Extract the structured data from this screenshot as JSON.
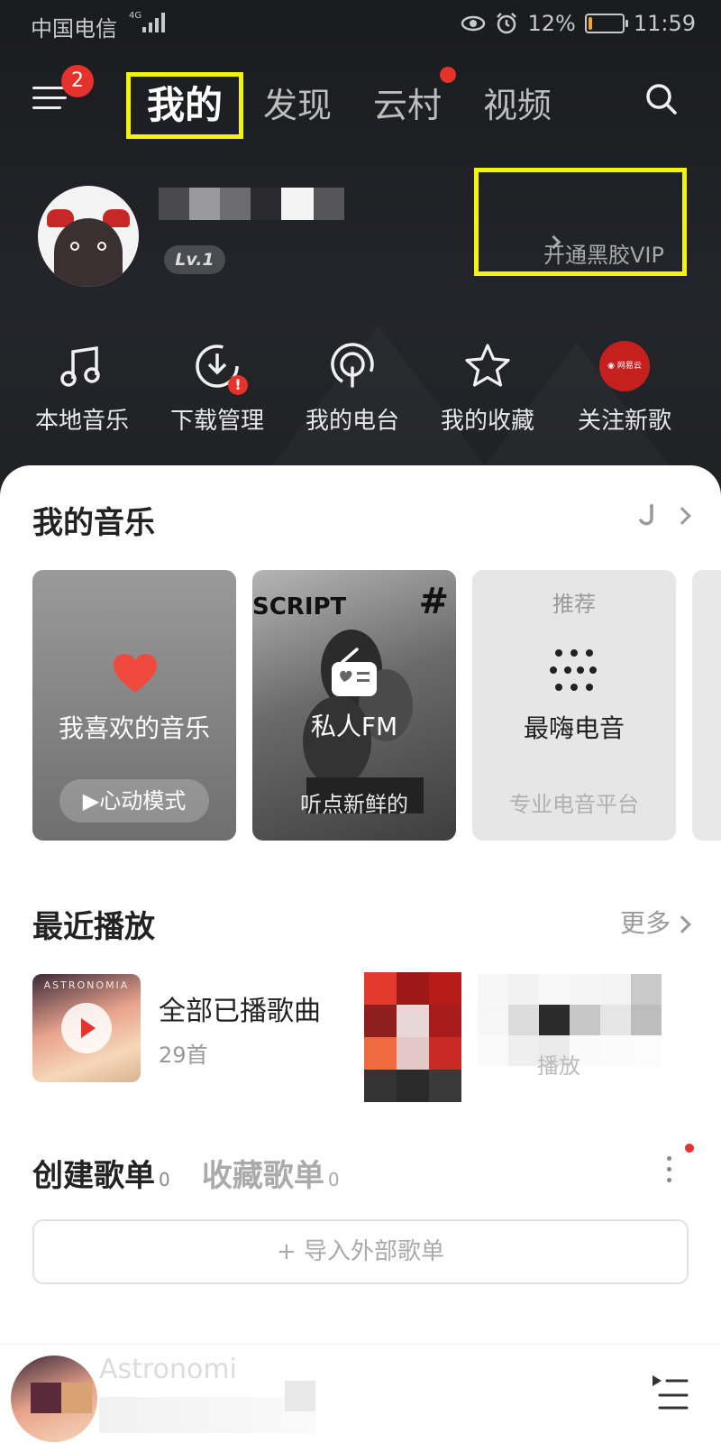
{
  "status_bar": {
    "carrier": "中国电信",
    "network": "4G",
    "battery": "12%",
    "time": "11:59",
    "battery_level": 0.12
  },
  "top_nav": {
    "menu_badge": "2",
    "tabs": [
      {
        "label": "我的",
        "active": true
      },
      {
        "label": "发现",
        "active": false
      },
      {
        "label": "云村",
        "active": false,
        "dot": true
      },
      {
        "label": "视频",
        "active": false
      }
    ]
  },
  "profile": {
    "level": "Lv.1",
    "vip_label": "开通黑胶VIP"
  },
  "quick_actions": [
    {
      "label": "本地音乐",
      "icon": "music-note-icon"
    },
    {
      "label": "下载管理",
      "icon": "download-icon",
      "badge": "!"
    },
    {
      "label": "我的电台",
      "icon": "podcast-icon"
    },
    {
      "label": "我的收藏",
      "icon": "star-icon"
    },
    {
      "label": "关注新歌",
      "icon": "netease-logo-icon"
    }
  ],
  "my_music": {
    "title": "我的音乐",
    "cards": [
      {
        "title": "我喜欢的音乐",
        "action": "▶心动模式"
      },
      {
        "title": "私人FM",
        "subtitle": "听点新鲜的",
        "cover_text": "SCRIPT",
        "cover_tag": "#"
      },
      {
        "tag": "推荐",
        "title": "最嗨电音",
        "subtitle": "专业电音平台"
      }
    ]
  },
  "recent": {
    "title": "最近播放",
    "more": "更多",
    "item": {
      "cover_text": "ASTRONOMIA",
      "title": "全部已播歌曲",
      "count": "29首"
    },
    "item2": {
      "subtitle_fragment": "播放"
    }
  },
  "playlists": {
    "created": {
      "label": "创建歌单",
      "count": "0"
    },
    "collected": {
      "label": "收藏歌单",
      "count": "0"
    },
    "import_label": "+ 导入外部歌单"
  },
  "player": {
    "song": "Astronomi"
  },
  "colors": {
    "accent": "#e5322d",
    "highlight": "#f4f40a",
    "dark_bg": "#1d1e22"
  }
}
